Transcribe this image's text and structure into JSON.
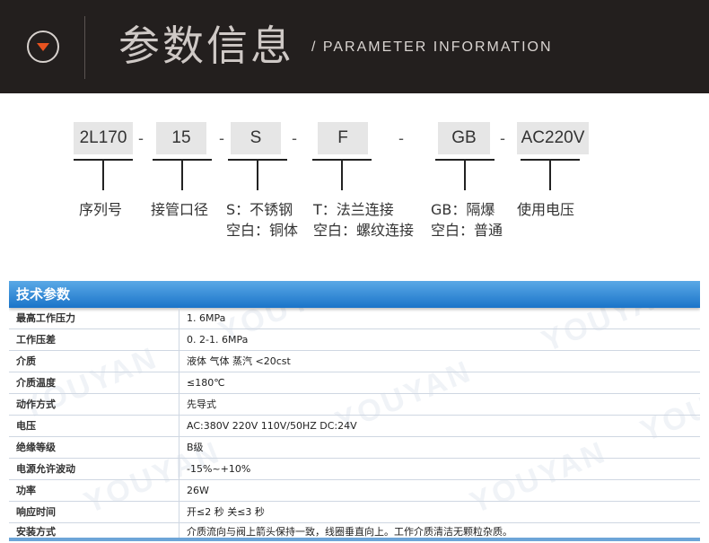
{
  "header": {
    "title_cn": "参数信息",
    "title_en": "/ PARAMETER INFORMATION",
    "icon": "chevron-down-circle-icon",
    "accent_color": "#e8531f",
    "background_color": "#231f1e"
  },
  "model_code": {
    "segments": [
      "2L170",
      "15",
      "S",
      "F",
      "GB",
      "AC220V"
    ],
    "separator": "-",
    "descriptions": [
      [
        "序列号"
      ],
      [
        "接管口径"
      ],
      [
        "S：不锈钢",
        "空白：铜体"
      ],
      [
        "T：法兰连接",
        "空白：螺纹连接"
      ],
      [
        "GB：隔爆",
        "空白：普通"
      ],
      [
        "使用电压"
      ]
    ]
  },
  "spec_table": {
    "title": "技术参数",
    "header_color": "#2a82d2",
    "watermark": "YOUYAN",
    "rows": [
      {
        "key": "最高工作压力",
        "value": "1. 6MPa"
      },
      {
        "key": "工作压差",
        "value": "0. 2-1. 6MPa"
      },
      {
        "key": "介质",
        "value": "液体  气体  蒸汽  <20cst"
      },
      {
        "key": "介质温度",
        "value": "≤180℃"
      },
      {
        "key": "动作方式",
        "value": "先导式"
      },
      {
        "key": "电压",
        "value": "AC:380V  220V  110V/50HZ  DC:24V"
      },
      {
        "key": "绝缘等级",
        "value": "B级"
      },
      {
        "key": "电源允许波动",
        "value": "-15%~+10%"
      },
      {
        "key": "功率",
        "value": "26W"
      },
      {
        "key": "响应时间",
        "value": "开≤2 秒    关≤3 秒"
      },
      {
        "key": "安装方式",
        "value": "介质流向与阀上箭头保持一致，线圈垂直向上。工作介质清洁无颗粒杂质。"
      }
    ]
  }
}
